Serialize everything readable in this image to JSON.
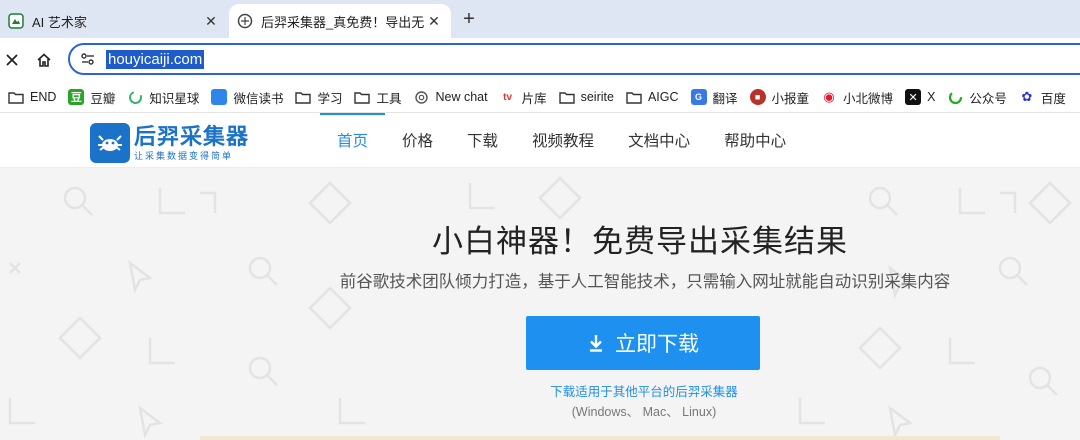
{
  "browser": {
    "tabs": [
      {
        "title": "AI 艺术家"
      },
      {
        "title": "后羿采集器_真免费！导出无限制"
      }
    ],
    "url": "houyicaiji.com",
    "bookmarks": [
      {
        "label": "END",
        "icon": "folder-icon"
      },
      {
        "label": "豆瓣",
        "icon": "douban-icon",
        "color": "#2aa52a"
      },
      {
        "label": "知识星球",
        "icon": "zsxq-icon",
        "color": "#35b46b"
      },
      {
        "label": "微信读书",
        "icon": "weread-icon",
        "color": "#2f86e9"
      },
      {
        "label": "学习",
        "icon": "folder-icon"
      },
      {
        "label": "工具",
        "icon": "folder-icon"
      },
      {
        "label": "New chat",
        "icon": "openai-icon",
        "color": "#6b6b6b"
      },
      {
        "label": "片库",
        "icon": "piankku-icon",
        "color": "#d33"
      },
      {
        "label": "seirite",
        "icon": "folder-icon"
      },
      {
        "label": "AIGC",
        "icon": "folder-icon"
      },
      {
        "label": "翻译",
        "icon": "translate-icon",
        "color": "#3a78e8"
      },
      {
        "label": "小报童",
        "icon": "xiaobaotong-icon",
        "color": "#b8322a"
      },
      {
        "label": "小北微博",
        "icon": "weibo-icon",
        "color": "#e6162d"
      },
      {
        "label": "X",
        "icon": "x-icon",
        "color": "#111"
      },
      {
        "label": "公众号",
        "icon": "wechat-icon",
        "color": "#16b316"
      },
      {
        "label": "百度",
        "icon": "baidu-icon",
        "color": "#2932e1"
      }
    ]
  },
  "site": {
    "logo_name": "后羿采集器",
    "logo_slogan": "让采集数据变得简单",
    "nav": [
      {
        "label": "首页",
        "active": true
      },
      {
        "label": "价格"
      },
      {
        "label": "下载"
      },
      {
        "label": "视频教程"
      },
      {
        "label": "文档中心"
      },
      {
        "label": "帮助中心"
      }
    ],
    "accent": "#1e90f0"
  },
  "hero": {
    "headline": "小白神器！免费导出采集结果",
    "subline": "前谷歌技术团队倾力打造，基于人工智能技术，只需输入网址就能自动识别采集内容",
    "download_label": "立即下载",
    "note": "下载适用于其他平台的后羿采集器",
    "platforms": "(Windows、 Mac、 Linux)"
  }
}
